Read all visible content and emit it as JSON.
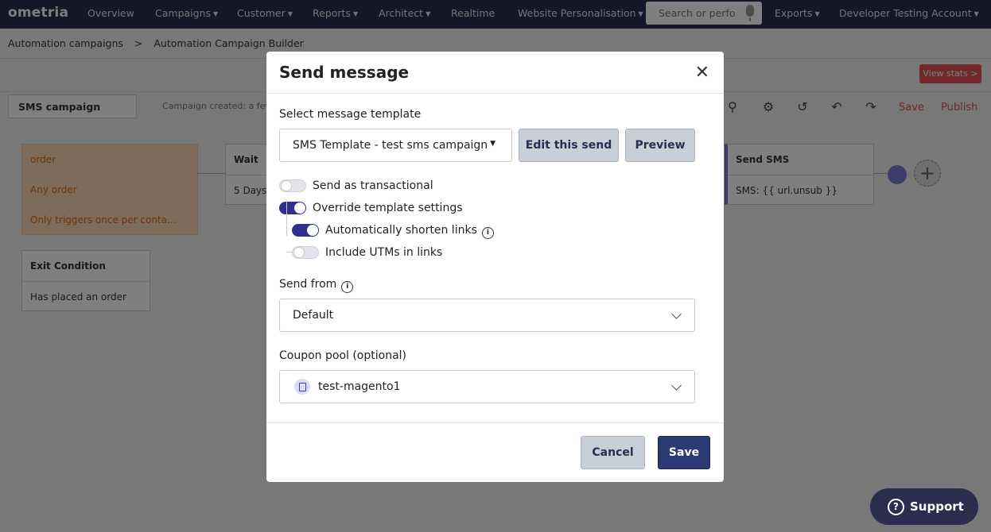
{
  "nav": {
    "logo": "ometria",
    "items": [
      "Overview",
      "Campaigns",
      "Customer",
      "Reports",
      "Architect",
      "Realtime",
      "Website Personalisation"
    ],
    "search_placeholder": "Search or perfo",
    "exports": "Exports",
    "account": "Developer Testing Account"
  },
  "breadcrumb": {
    "root": "Automation campaigns",
    "sep": ">",
    "current": "Automation Campaign Builder"
  },
  "toolbar": {
    "view_stats": "View stats >",
    "campaign_name": "SMS campaign",
    "created": "Campaign created: a few",
    "save": "Save",
    "publish": "Publish"
  },
  "canvas": {
    "trigger": {
      "title": "order",
      "row1": "Any order",
      "row2": "Only triggers once per conta..."
    },
    "wait": {
      "title": "Wait",
      "value": "5 Days"
    },
    "exit": {
      "title": "Exit Condition",
      "value": "Has placed an order"
    },
    "send_sms": {
      "title": "Send SMS",
      "value": "SMS: {{ url.unsub }}"
    }
  },
  "modal": {
    "title": "Send message",
    "template_label": "Select message template",
    "template_value": "SMS Template - test sms campaign (",
    "edit_btn": "Edit this send",
    "preview_btn": "Preview",
    "toggles": [
      {
        "label": "Send as transactional",
        "on": false
      },
      {
        "label": "Override template settings",
        "on": true
      },
      {
        "label": "Automatically shorten links",
        "on": true
      },
      {
        "label": "Include UTMs in links",
        "on": false
      }
    ],
    "send_from_label": "Send from",
    "send_from_value": "Default",
    "coupon_label": "Coupon pool (optional)",
    "coupon_value": "test-magento1",
    "cancel": "Cancel",
    "save": "Save"
  },
  "support": {
    "label": "Support"
  }
}
